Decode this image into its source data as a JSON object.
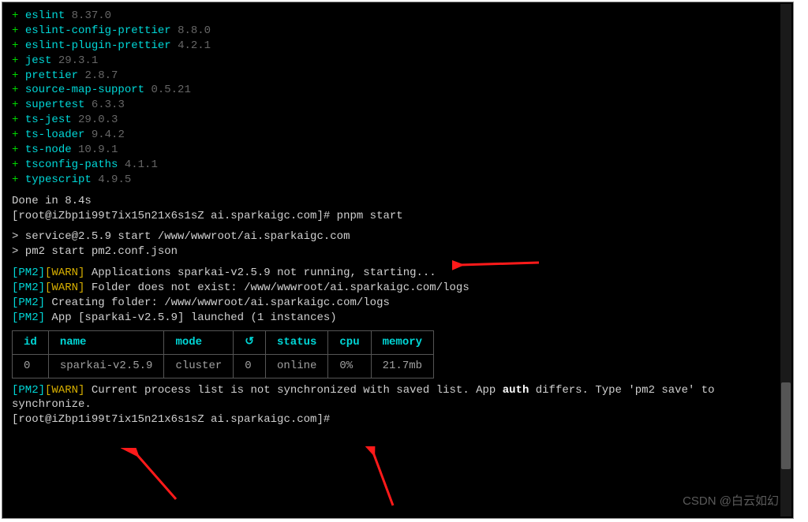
{
  "packages": [
    {
      "name": "eslint",
      "version": "8.37.0"
    },
    {
      "name": "eslint-config-prettier",
      "version": "8.8.0"
    },
    {
      "name": "eslint-plugin-prettier",
      "version": "4.2.1"
    },
    {
      "name": "jest",
      "version": "29.3.1"
    },
    {
      "name": "prettier",
      "version": "2.8.7"
    },
    {
      "name": "source-map-support",
      "version": "0.5.21"
    },
    {
      "name": "supertest",
      "version": "6.3.3"
    },
    {
      "name": "ts-jest",
      "version": "29.0.3"
    },
    {
      "name": "ts-loader",
      "version": "9.4.2"
    },
    {
      "name": "ts-node",
      "version": "10.9.1"
    },
    {
      "name": "tsconfig-paths",
      "version": "4.1.1"
    },
    {
      "name": "typescript",
      "version": "4.9.5"
    }
  ],
  "done_line": "Done in 8.4s",
  "prompt1": {
    "text": "[root@iZbp1i99t7ix15n21x6s1sZ ai.sparkaigc.com]# ",
    "cmd": "pnpm start"
  },
  "start_lines": [
    "> service@2.5.9 start /www/wwwroot/ai.sparkaigc.com",
    "> pm2 start pm2.conf.json"
  ],
  "pm2_lines": [
    {
      "tags": [
        [
          "pm2",
          "[PM2]"
        ],
        [
          "warn",
          "[WARN]"
        ]
      ],
      "text": " Applications sparkai-v2.5.9 not running, starting..."
    },
    {
      "tags": [
        [
          "pm2",
          "[PM2]"
        ],
        [
          "warn",
          "[WARN]"
        ]
      ],
      "text": " Folder does not exist: /www/wwwroot/ai.sparkaigc.com/logs"
    },
    {
      "tags": [
        [
          "pm2",
          "[PM2]"
        ]
      ],
      "text": " Creating folder: /www/wwwroot/ai.sparkaigc.com/logs"
    },
    {
      "tags": [
        [
          "pm2",
          "[PM2]"
        ]
      ],
      "text": " App [sparkai-v2.5.9] launched (1 instances)"
    }
  ],
  "table_headers": [
    "id",
    "name",
    "mode",
    "↺",
    "status",
    "cpu",
    "memory"
  ],
  "table_row": {
    "id": "0",
    "name": "sparkai-v2.5.9",
    "mode": "cluster",
    "restart": "0",
    "status": "online",
    "cpu": "0%",
    "memory": "21.7mb"
  },
  "final_warn": {
    "pre": "Current process list is not synchronized with saved list. App ",
    "bold": "auth",
    "post": " differs. Type 'pm2 save' to synchronize."
  },
  "prompt2": {
    "text": "[root@iZbp1i99t7ix15n21x6s1sZ ai.sparkaigc.com]# "
  },
  "watermark": "CSDN @白云如幻",
  "colors": {
    "green": "#00d700",
    "cyan": "#00d7d7",
    "gray": "#666",
    "yellow": "#d7af00",
    "bg": "#000",
    "fg": "#d0d0d0",
    "arrow": "#ff1a1a"
  }
}
